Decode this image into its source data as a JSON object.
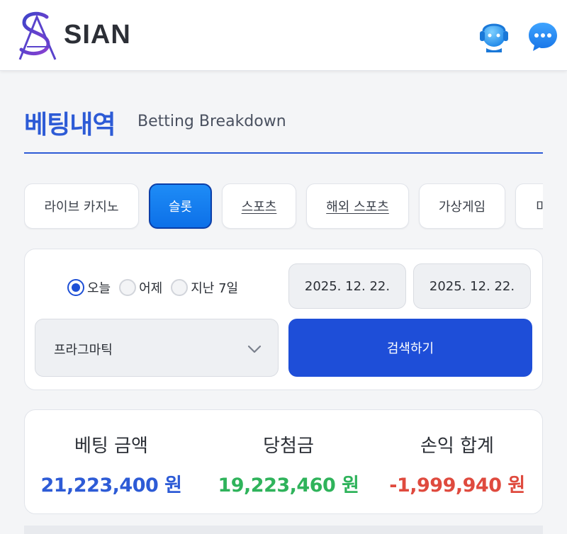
{
  "header": {
    "brand": "SIAN",
    "logo_icon": "sian-logo-icon",
    "support_icon": "support-agent-icon",
    "chat_icon": "chat-bubble-icon"
  },
  "page": {
    "title_ko": "베팅내역",
    "title_en": "Betting Breakdown"
  },
  "tabs": [
    {
      "label": "라이브 카지노",
      "active": false
    },
    {
      "label": "슬롯",
      "active": true
    },
    {
      "label": "스포츠",
      "active": false
    },
    {
      "label": "해외 스포츠",
      "active": false
    },
    {
      "label": "가상게임",
      "active": false
    },
    {
      "label": "미",
      "active": false
    }
  ],
  "search": {
    "period_options": [
      {
        "label": "오늘",
        "checked": true
      },
      {
        "label": "어제",
        "checked": false
      },
      {
        "label": "지난 7일",
        "checked": false
      }
    ],
    "date_from": "2025. 12. 22.",
    "date_to": "2025. 12. 22.",
    "provider": "프라그마틱",
    "submit_label": "검색하기"
  },
  "summary": {
    "bet_label": "베팅 금액",
    "bet_value": "21,223,400 원",
    "win_label": "당첨금",
    "win_value": "19,223,460 원",
    "profit_label": "손익 합계",
    "profit_value": "-1,999,940 원"
  },
  "colors": {
    "accent": "#2d5bd6",
    "button": "#1e4ed8",
    "active_tab": "#1e8cf6",
    "positive": "#2fb35b",
    "negative": "#df4a3e"
  }
}
